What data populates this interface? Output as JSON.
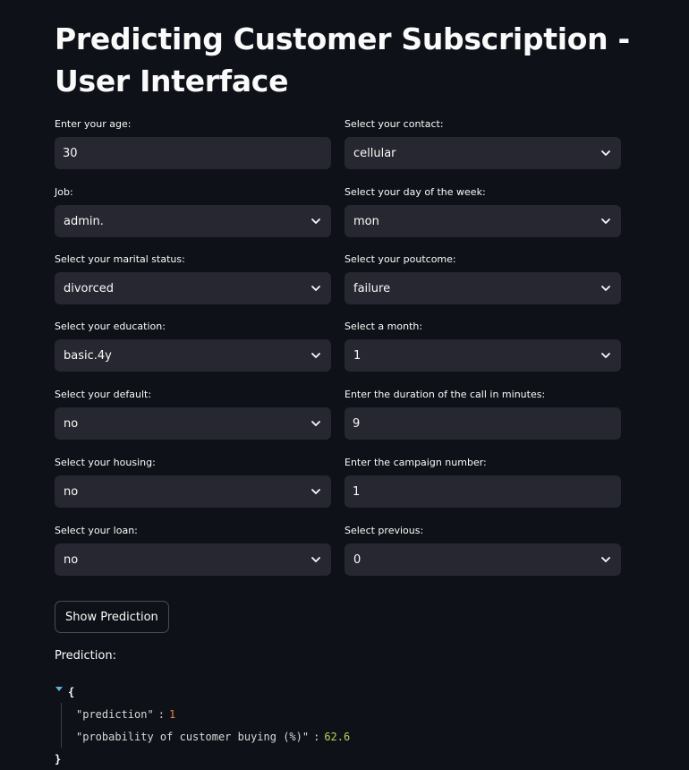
{
  "title": "Predicting Customer Subscription - User Interface",
  "fields": {
    "age": {
      "label": "Enter your age:",
      "value": "30"
    },
    "contact": {
      "label": "Select your contact:",
      "value": "cellular"
    },
    "job": {
      "label": "Job:",
      "value": "admin."
    },
    "day_of_week": {
      "label": "Select your day of the week:",
      "value": "mon"
    },
    "marital": {
      "label": "Select your marital status:",
      "value": "divorced"
    },
    "poutcome": {
      "label": "Select your poutcome:",
      "value": "failure"
    },
    "education": {
      "label": "Select your education:",
      "value": "basic.4y"
    },
    "month": {
      "label": "Select a month:",
      "value": "1"
    },
    "default": {
      "label": "Select your default:",
      "value": "no"
    },
    "duration": {
      "label": "Enter the duration of the call in minutes:",
      "value": "9"
    },
    "housing": {
      "label": "Select your housing:",
      "value": "no"
    },
    "campaign": {
      "label": "Enter the campaign number:",
      "value": "1"
    },
    "loan": {
      "label": "Select your loan:",
      "value": "no"
    },
    "previous": {
      "label": "Select previous:",
      "value": "0"
    }
  },
  "button": {
    "label": "Show Prediction"
  },
  "prediction": {
    "label": "Prediction:",
    "open_brace": "{",
    "close_brace": "}",
    "key1": "\"prediction\"",
    "value1": "1",
    "key2": "\"probability of customer buying (%)\"",
    "value2": "62.6",
    "colon": ":"
  },
  "colors": {
    "background": "#0e1117",
    "control_bg": "#262730",
    "text": "#fafafa",
    "json_number_int": "#e8824b",
    "json_number_float": "#b5d35a",
    "json_toggle": "#5fb3d9"
  },
  "icons": {
    "select_chevron": "chevron-down-icon",
    "json_toggle": "caret-down-icon"
  }
}
